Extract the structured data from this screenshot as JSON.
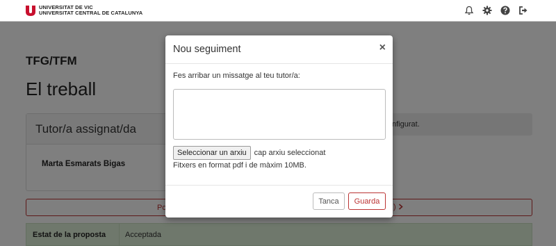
{
  "header": {
    "brand_line1": "UNIVERSITAT DE VIC",
    "brand_line2": "UNIVERSITAT CENTRAL DE CATALUNYA",
    "icons": [
      "bell-icon",
      "gear-icon",
      "help-icon",
      "logout-icon"
    ],
    "brand_color": "#c8102e"
  },
  "page": {
    "section_label": "TFG/TFM",
    "title": "El treball",
    "tutor_card_title": "Tutor/a assignat/da",
    "tutor_name": "Marta Esmarats Bigas",
    "notice_text": "nfigurat.",
    "action_left_text": "Po",
    "action_right_text": ")",
    "status_key": "Estat de la proposta",
    "status_value": "Acceptada"
  },
  "modal": {
    "title": "Nou seguiment",
    "close_label": "×",
    "prompt": "Fes arribar un missatge al teu tutor/a:",
    "message_value": "",
    "file_button_label": "Seleccionar un arxiu",
    "file_status": "cap arxiu seleccionat",
    "file_hint": "Fitxers en format pdf i de màxim 10MB.",
    "cancel_label": "Tanca",
    "save_label": "Guarda"
  }
}
